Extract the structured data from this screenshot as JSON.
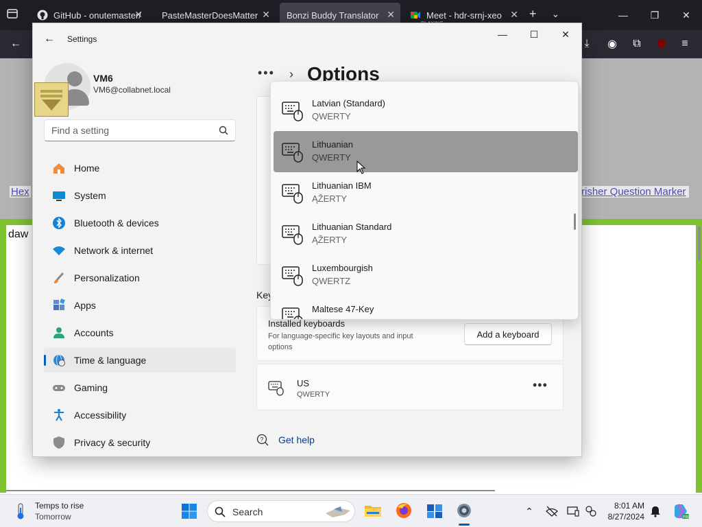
{
  "browser": {
    "tabs": [
      {
        "title": "GitHub - onutemaster/"
      },
      {
        "title": "PasteMasterDoesMatter"
      },
      {
        "title": "Bonzi Buddy Translator"
      },
      {
        "title": "Meet - hdr-srnj-xeo",
        "sub": "PLAYING"
      }
    ],
    "page": {
      "hex_link": "Hex",
      "marker_link": "risher Question Marker",
      "body_text": "daw"
    }
  },
  "settings": {
    "window_title": "Settings",
    "user": {
      "name": "VM6",
      "email": "VM6@collabnet.local"
    },
    "search": {
      "placeholder": "Find a setting"
    },
    "nav": [
      {
        "label": "Home",
        "icon": "home-icon"
      },
      {
        "label": "System",
        "icon": "system-icon"
      },
      {
        "label": "Bluetooth & devices",
        "icon": "bluetooth-icon"
      },
      {
        "label": "Network & internet",
        "icon": "wifi-icon"
      },
      {
        "label": "Personalization",
        "icon": "brush-icon"
      },
      {
        "label": "Apps",
        "icon": "apps-icon"
      },
      {
        "label": "Accounts",
        "icon": "account-icon"
      },
      {
        "label": "Time & language",
        "icon": "globe-clock-icon",
        "selected": true
      },
      {
        "label": "Gaming",
        "icon": "gamepad-icon"
      },
      {
        "label": "Accessibility",
        "icon": "accessibility-icon"
      },
      {
        "label": "Privacy & security",
        "icon": "shield-icon"
      }
    ],
    "breadcrumb": {
      "more": "•••",
      "title": "Options"
    },
    "section_label": "Key",
    "installed": {
      "title": "Installed keyboards",
      "description": "For language-specific key layouts and input options",
      "add_button": "Add a keyboard"
    },
    "keyboard": {
      "name": "US",
      "layout": "QWERTY",
      "more": "•••"
    },
    "help": "Get help",
    "dropdown": [
      {
        "name": "Latvian (Standard)",
        "layout": "QWERTY"
      },
      {
        "name": "Lithuanian",
        "layout": "QWERTY",
        "highlighted": true
      },
      {
        "name": "Lithuanian IBM",
        "layout": "ĄŽERTY"
      },
      {
        "name": "Lithuanian Standard",
        "layout": "ĄŽERTY"
      },
      {
        "name": "Luxembourgish",
        "layout": "QWERTZ"
      },
      {
        "name": "Maltese 47-Key",
        "layout": ""
      }
    ]
  },
  "taskbar": {
    "weather": {
      "title": "Temps to rise",
      "subtitle": "Tomorrow"
    },
    "search_label": "Search",
    "clock": {
      "time": "8:01 AM",
      "date": "8/27/2024"
    }
  },
  "colors": {
    "accent": "#005fb8",
    "dropdown_highlight": "#999999",
    "page_frame": "#7ec232",
    "browser_chrome": "#1f1e25"
  }
}
